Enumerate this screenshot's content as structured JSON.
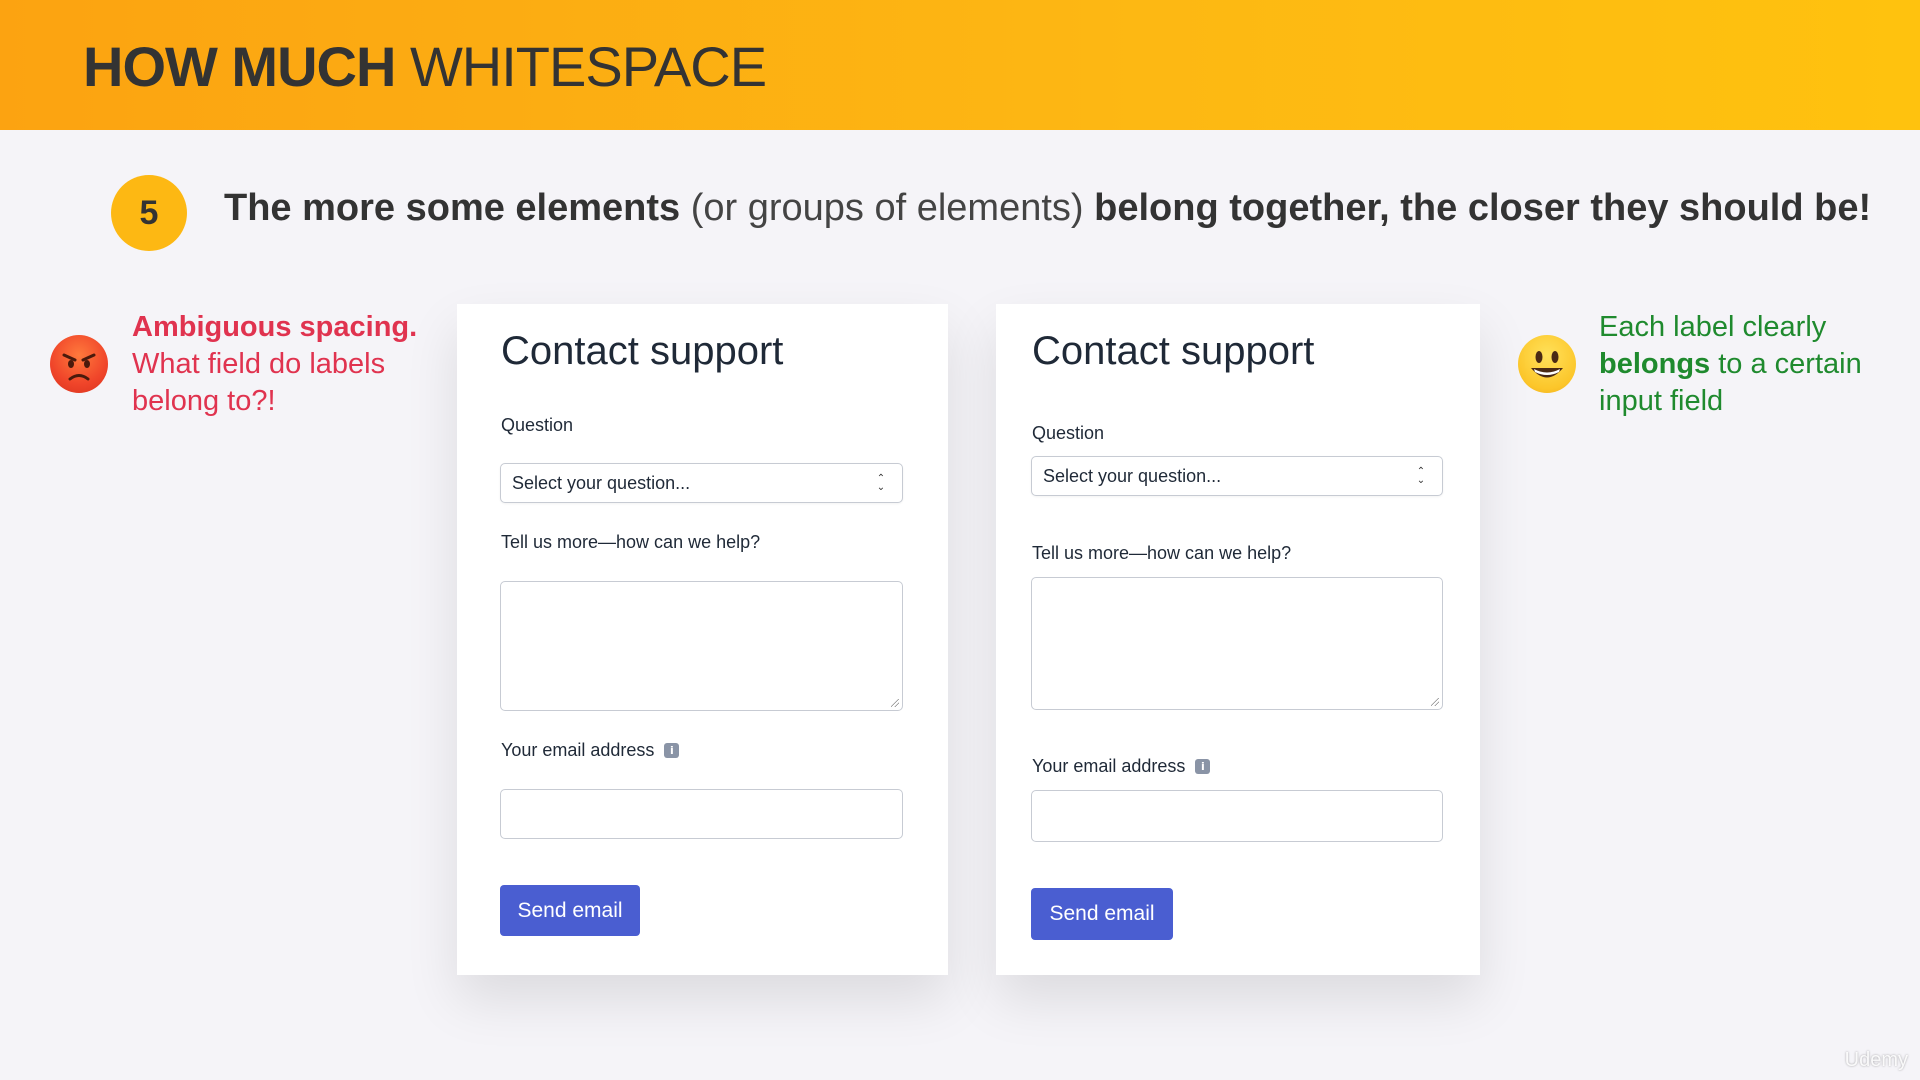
{
  "banner": {
    "title_bold": "HOW MUCH",
    "title_light": " WHITESPACE",
    "color": "#fdb813"
  },
  "principle": {
    "number": "5",
    "part1": "The more some elements",
    "part2": " (or groups of elements) ",
    "part3": "belong together, the closer they should be!"
  },
  "bad_note": {
    "emoji": "angry-face-icon",
    "strong": "Ambiguous spacing.",
    "rest": "What field do labels belong to?!",
    "color": "#e0334f"
  },
  "good_note": {
    "emoji": "smiling-face-icon",
    "line1": "Each label clearly",
    "strong": "belongs",
    "rest": " to a certain input field",
    "color": "#1f8a2e"
  },
  "form_bad": {
    "title": "Contact support",
    "question_label": "Question",
    "question_select": "Select your question...",
    "help_label": "Tell us more—how can we help?",
    "email_label": "Your email address",
    "send_label": "Send email"
  },
  "form_good": {
    "title": "Contact support",
    "question_label": "Question",
    "question_select": "Select your question...",
    "help_label": "Tell us more—how can we help?",
    "email_label": "Your email address",
    "send_label": "Send email"
  },
  "button_color": "#4a5ed1",
  "watermark": "Udemy"
}
